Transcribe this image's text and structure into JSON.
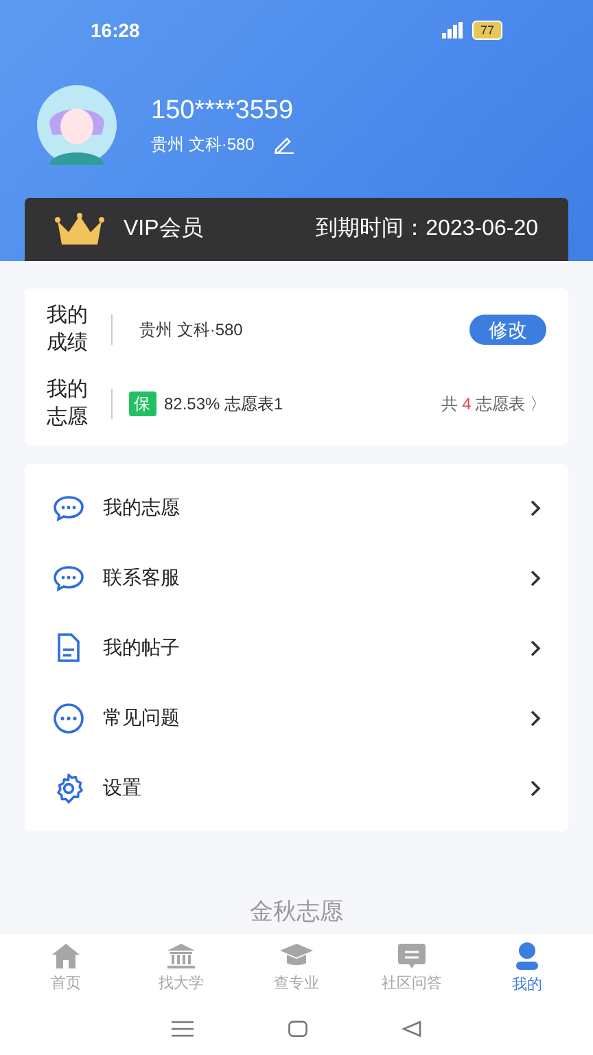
{
  "status_bar": {
    "time": "16:28",
    "battery": "77"
  },
  "profile": {
    "phone": "150****3559",
    "info": "贵州 文科·580"
  },
  "vip": {
    "label": "VIP会员",
    "expiry_label": "到期时间：",
    "expiry_date": "2023-06-20"
  },
  "score": {
    "label": "我的成绩",
    "value": "贵州 文科·580",
    "button": "修改"
  },
  "wishes": {
    "label": "我的志愿",
    "tag": "保",
    "summary": "82.53% 志愿表1",
    "count_prefix": "共",
    "count": "4",
    "count_suffix": "志愿表",
    "chevron": "〉"
  },
  "menu": [
    {
      "kind": "chat",
      "label": "我的志愿"
    },
    {
      "kind": "chat",
      "label": "联系客服"
    },
    {
      "kind": "document",
      "label": "我的帖子"
    },
    {
      "kind": "dots",
      "label": "常见问题"
    },
    {
      "kind": "gear",
      "label": "设置"
    }
  ],
  "footer_title": "金秋志愿",
  "tabs": [
    {
      "kind": "home",
      "label": "首页",
      "selected": false
    },
    {
      "kind": "bank",
      "label": "找大学",
      "selected": false
    },
    {
      "kind": "cap",
      "label": "查专业",
      "selected": false
    },
    {
      "kind": "message",
      "label": "社区问答",
      "selected": false
    },
    {
      "kind": "user",
      "label": "我的",
      "selected": true
    }
  ]
}
